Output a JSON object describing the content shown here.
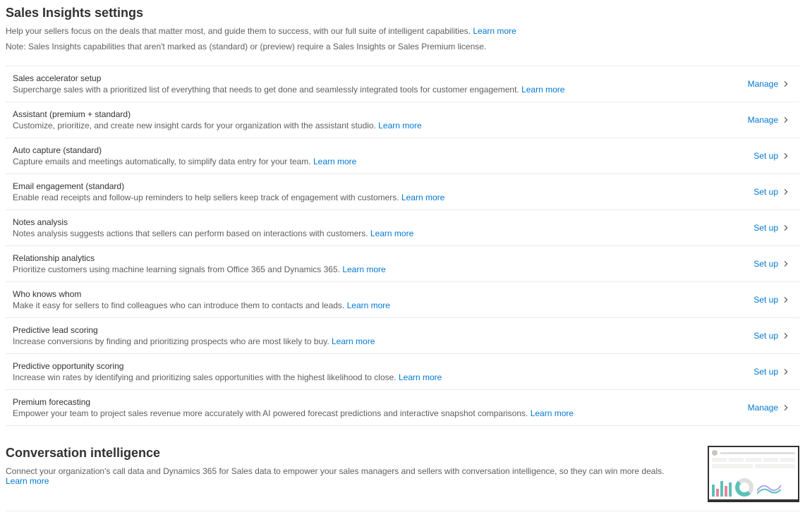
{
  "header": {
    "title": "Sales Insights settings",
    "subtitle": "Help your sellers focus on the deals that matter most, and guide them to success, with our full suite of intelligent capabilities.",
    "learn_more": "Learn more",
    "note": "Note: Sales Insights capabilities that aren't marked as (standard) or (preview) require a Sales Insights or Sales Premium license."
  },
  "labels": {
    "learn_more": "Learn more",
    "manage": "Manage",
    "set_up": "Set up"
  },
  "items": [
    {
      "title": "Sales accelerator setup",
      "desc": "Supercharge sales with a prioritized list of everything that needs to get done and seamlessly integrated tools for customer engagement.",
      "action": "Manage"
    },
    {
      "title": "Assistant (premium + standard)",
      "desc": "Customize, prioritize, and create new insight cards for your organization with the assistant studio.",
      "action": "Manage"
    },
    {
      "title": "Auto capture (standard)",
      "desc": "Capture emails and meetings automatically, to simplify data entry for your team.",
      "action": "Set up"
    },
    {
      "title": "Email engagement (standard)",
      "desc": "Enable read receipts and follow-up reminders to help sellers keep track of engagement with customers.",
      "action": "Set up"
    },
    {
      "title": "Notes analysis",
      "desc": "Notes analysis suggests actions that sellers can perform based on interactions with customers.",
      "action": "Set up"
    },
    {
      "title": "Relationship analytics",
      "desc": "Prioritize customers using machine learning signals from Office 365 and Dynamics 365.",
      "action": "Set up"
    },
    {
      "title": "Who knows whom",
      "desc": "Make it easy for sellers to find colleagues who can introduce them to contacts and leads.",
      "action": "Set up"
    },
    {
      "title": "Predictive lead scoring",
      "desc": "Increase conversions by finding and prioritizing prospects who are most likely to buy.",
      "action": "Set up"
    },
    {
      "title": "Predictive opportunity scoring",
      "desc": "Increase win rates by identifying and prioritizing sales opportunities with the highest likelihood to close.",
      "action": "Set up"
    },
    {
      "title": "Premium forecasting",
      "desc": "Empower your team to project sales revenue more accurately with AI powered forecast predictions and interactive snapshot comparisons.",
      "action": "Manage"
    }
  ],
  "conversation": {
    "title": "Conversation intelligence",
    "subtitle": "Connect your organization's call data and Dynamics 365 for Sales data to empower your sales managers and sellers with conversation intelligence, so they can win more deals.",
    "learn_more": "Learn more"
  }
}
